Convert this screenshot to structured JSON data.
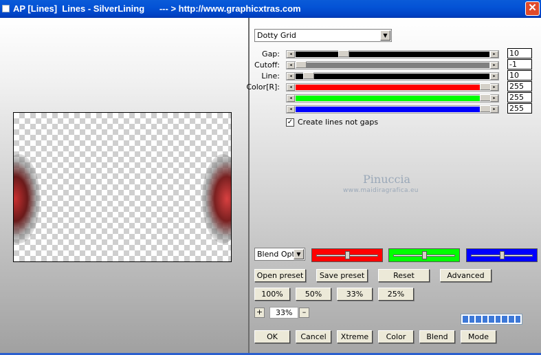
{
  "window": {
    "title": "AP [Lines]  Lines - SilverLining      --- > http://www.graphicxtras.com",
    "close_label": "✕"
  },
  "controls": {
    "preset": "Dotty Grid",
    "sliders": [
      {
        "label": "Gap:",
        "value": "10",
        "color": "#000000",
        "level": 0.23
      },
      {
        "label": "Cutoff:",
        "value": "-1",
        "color": "#808080",
        "level": 0.0
      },
      {
        "label": "Line:",
        "value": "10",
        "color": "#000000",
        "level": 0.04
      },
      {
        "label": "Color[R]:",
        "value": "255",
        "color": "#ff0000",
        "level": 1.0
      },
      {
        "label": "",
        "value": "255",
        "color": "#00ff00",
        "level": 1.0
      },
      {
        "label": "",
        "value": "255",
        "color": "#0000ff",
        "level": 1.0
      }
    ],
    "checkbox": {
      "label": "Create lines not gaps",
      "checked": true,
      "mark": "✓"
    }
  },
  "watermark": {
    "line1": "Pinuccia",
    "line2": "www.maidiragrafica.eu"
  },
  "blend": {
    "select_value": "Blend Options",
    "color_bars": [
      {
        "color": "#ff0000",
        "level": 0.48
      },
      {
        "color": "#00ff00",
        "level": 0.48
      },
      {
        "color": "#0000ff",
        "level": 0.48
      }
    ]
  },
  "buttons": {
    "open_preset": "Open preset",
    "save_preset": "Save preset",
    "reset": "Reset",
    "advanced": "Advanced",
    "zoom_100": "100%",
    "zoom_50": "50%",
    "zoom_33": "33%",
    "zoom_25": "25%",
    "ok": "OK",
    "cancel": "Cancel",
    "xtreme": "Xtreme",
    "color": "Color",
    "blend": "Blend",
    "mode": "Mode"
  },
  "zoom": {
    "plus": "+",
    "minus": "–",
    "value": "33%"
  },
  "progress": {
    "segments": 9
  }
}
